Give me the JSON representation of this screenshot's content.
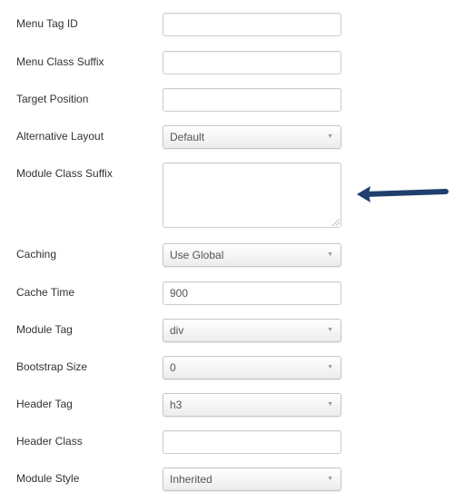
{
  "fields": [
    {
      "label": "Menu Tag ID",
      "type": "text",
      "value": ""
    },
    {
      "label": "Menu Class Suffix",
      "type": "text",
      "value": ""
    },
    {
      "label": "Target Position",
      "type": "text",
      "value": ""
    },
    {
      "label": "Alternative Layout",
      "type": "select",
      "value": "Default"
    },
    {
      "label": "Module Class Suffix",
      "type": "textarea",
      "value": ""
    },
    {
      "label": "Caching",
      "type": "select",
      "value": "Use Global"
    },
    {
      "label": "Cache Time",
      "type": "text",
      "value": "900"
    },
    {
      "label": "Module Tag",
      "type": "select",
      "value": "div"
    },
    {
      "label": "Bootstrap Size",
      "type": "select",
      "value": "0"
    },
    {
      "label": "Header Tag",
      "type": "select",
      "value": "h3"
    },
    {
      "label": "Header Class",
      "type": "text",
      "value": ""
    },
    {
      "label": "Module Style",
      "type": "select",
      "value": "Inherited"
    }
  ],
  "annotation": {
    "arrow_color": "#1f3f6e",
    "points_to": "Module Class Suffix"
  },
  "icons": {
    "select_caret": "caret-down-icon",
    "resize": "resize-grip-icon",
    "arrow": "arrow-left-icon"
  }
}
